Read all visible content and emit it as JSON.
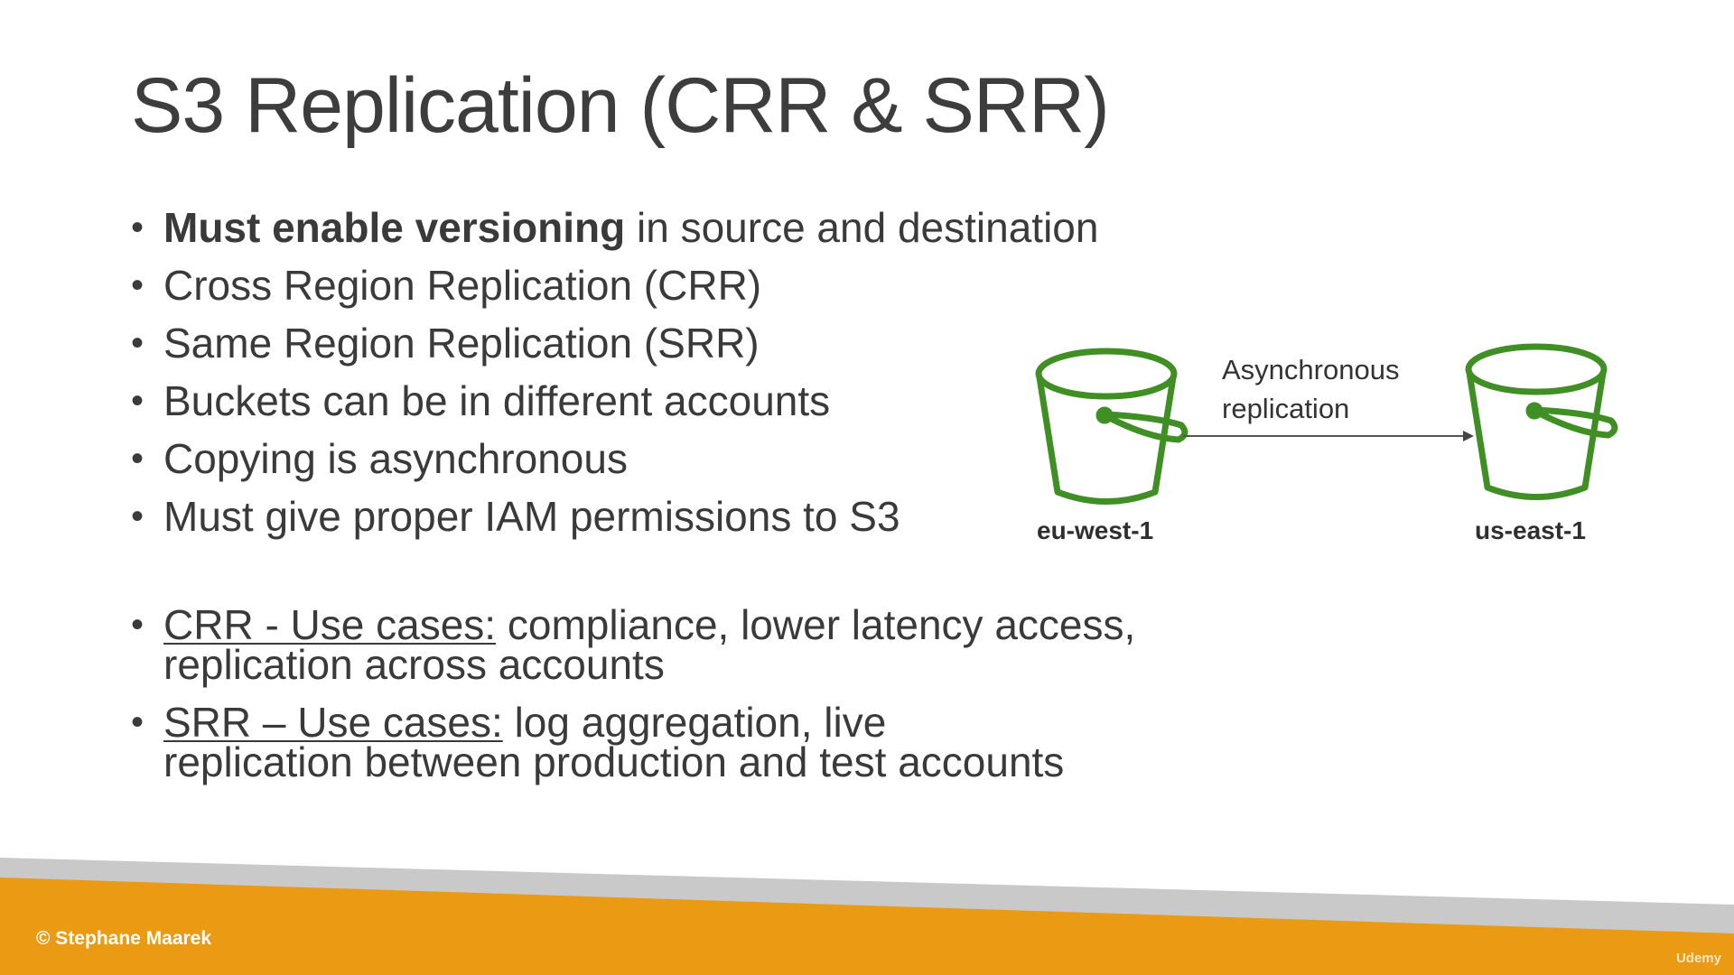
{
  "slide": {
    "title": "S3 Replication (CRR & SRR)",
    "bullets": [
      {
        "bold": "Must enable versioning",
        "rest": " in source and destination"
      },
      {
        "text": "Cross Region Replication (CRR)"
      },
      {
        "text": "Same Region Replication (SRR)"
      },
      {
        "text": "Buckets can be in different accounts"
      },
      {
        "text": "Copying is asynchronous"
      },
      {
        "text": "Must give proper IAM permissions to S3"
      }
    ],
    "use_cases": [
      {
        "underlined": "CRR - Use cases:",
        "rest": " compliance, lower latency access, replication across accounts"
      },
      {
        "underlined": "SRR – Use cases:",
        "rest": " log aggregation, live replication between production and test accounts"
      }
    ]
  },
  "diagram": {
    "source_region": "eu-west-1",
    "destination_region": "us-east-1",
    "arrow_label_line1": "Asynchronous",
    "arrow_label_line2": "replication",
    "bucket_icon": "s3-bucket-icon",
    "arrow_icon": "arrow-right-icon",
    "bucket_color": "#3f8f24"
  },
  "footer": {
    "copyright": "© Stephane Maarek",
    "watermark": "Udemy",
    "accent_color": "#eb9a14",
    "stripe_color": "#c9c9c9"
  }
}
